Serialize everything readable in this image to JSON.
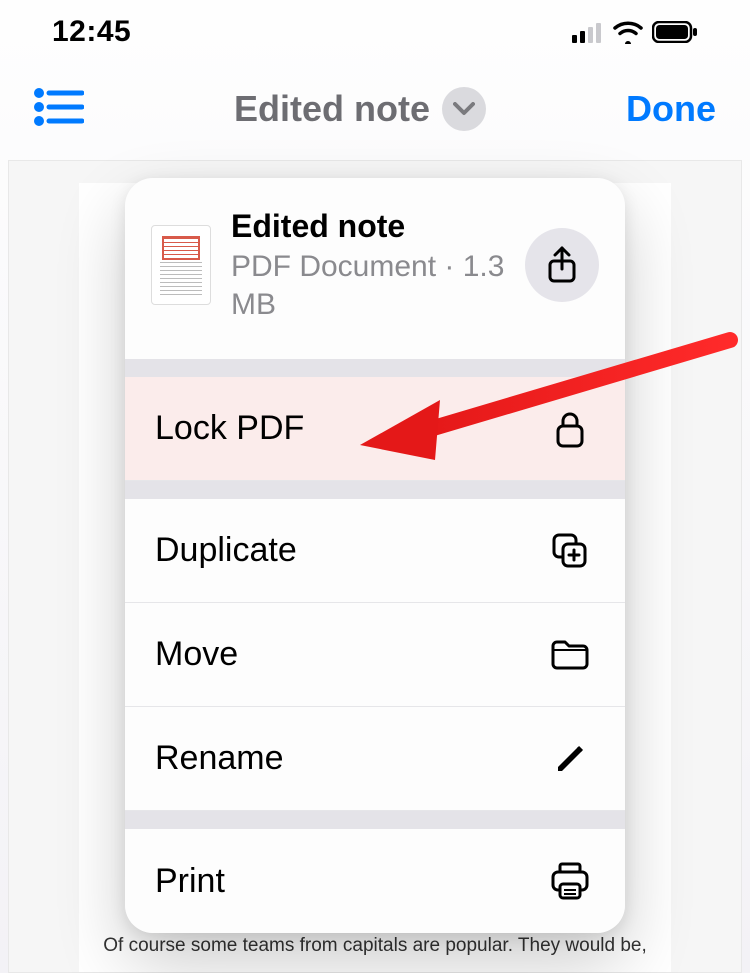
{
  "status": {
    "time": "12:45"
  },
  "nav": {
    "title": "Edited note",
    "done": "Done"
  },
  "sheet": {
    "title": "Edited note",
    "subtitle": "PDF Document · 1.3 MB",
    "actions": {
      "lock": "Lock PDF",
      "duplicate": "Duplicate",
      "move": "Move",
      "rename": "Rename",
      "print": "Print"
    }
  },
  "background_doc": {
    "visible_line": "Of course some teams from capitals are popular. They would be,"
  }
}
